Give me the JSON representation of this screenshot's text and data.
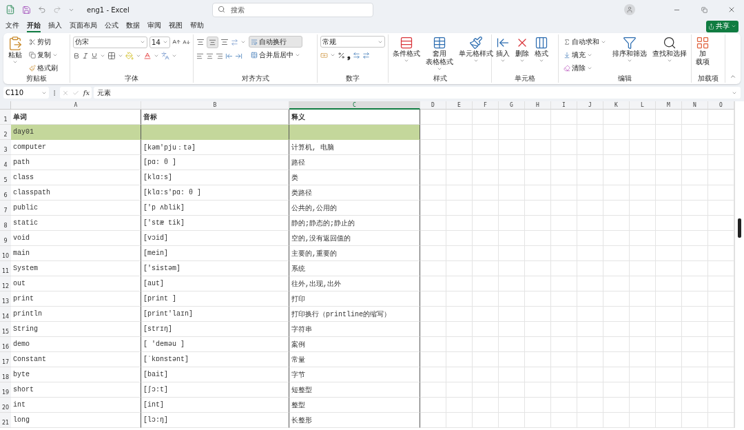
{
  "window": {
    "title": "eng1 - Excel"
  },
  "search": {
    "placeholder": "搜索"
  },
  "menu_tabs": [
    {
      "label": "文件",
      "selected": false
    },
    {
      "label": "开始",
      "selected": true
    },
    {
      "label": "插入",
      "selected": false
    },
    {
      "label": "页面布局",
      "selected": false
    },
    {
      "label": "公式",
      "selected": false
    },
    {
      "label": "数据",
      "selected": false
    },
    {
      "label": "审阅",
      "selected": false
    },
    {
      "label": "视图",
      "selected": false
    },
    {
      "label": "帮助",
      "selected": false
    }
  ],
  "share_button": "共享",
  "ribbon": {
    "clipboard": {
      "label": "剪贴板",
      "paste": "粘贴",
      "cut": "剪切",
      "copy": "复制",
      "format_painter": "格式刷"
    },
    "font": {
      "label": "字体",
      "font_name": "仿宋",
      "font_size": "14"
    },
    "alignment": {
      "label": "对齐方式",
      "middle_align_pressed": true,
      "wrap_text": {
        "label": "自动换行",
        "pressed": true
      },
      "merge": "合并后居中"
    },
    "number": {
      "label": "数字",
      "format": "常规",
      "comma": "❟"
    },
    "styles": {
      "label": "样式",
      "buttons": [
        {
          "kind": "conditional",
          "lines": [
            "条件格式"
          ]
        },
        {
          "kind": "table",
          "lines": [
            "套用",
            "表格格式"
          ]
        },
        {
          "kind": "cellstyle",
          "lines": [
            "单元格样式"
          ]
        }
      ]
    },
    "cells": {
      "label": "单元格",
      "buttons": [
        {
          "kind": "insert",
          "lines": [
            "插入"
          ]
        },
        {
          "kind": "delete",
          "lines": [
            "删除"
          ]
        },
        {
          "kind": "format",
          "lines": [
            "格式"
          ]
        }
      ]
    },
    "editing": {
      "label": "编辑",
      "autosum": "自动求和",
      "fill": "填充",
      "clear": "清除",
      "sort": "排序和筛选",
      "find": "查找和选择"
    },
    "addins": {
      "label": "加载项",
      "lines": [
        "加",
        "载项"
      ]
    }
  },
  "formula_bar": {
    "name_box": "C110",
    "fx": "fx",
    "value": "元素"
  },
  "sheet": {
    "columns": [
      {
        "label": "A",
        "selected": false
      },
      {
        "label": "B",
        "selected": false
      },
      {
        "label": "C",
        "selected": true
      },
      {
        "label": "D",
        "selected": false
      },
      {
        "label": "E",
        "selected": false
      },
      {
        "label": "F",
        "selected": false
      },
      {
        "label": "G",
        "selected": false
      },
      {
        "label": "H",
        "selected": false
      },
      {
        "label": "I",
        "selected": false
      },
      {
        "label": "J",
        "selected": false
      },
      {
        "label": "K",
        "selected": false
      },
      {
        "label": "L",
        "selected": false
      },
      {
        "label": "M",
        "selected": false
      },
      {
        "label": "N",
        "selected": false
      },
      {
        "label": "O",
        "selected": false
      }
    ],
    "rows": [
      {
        "number": "1",
        "kind": "header",
        "cells": [
          "单词",
          "音标",
          "释义"
        ]
      },
      {
        "number": "2",
        "kind": "group",
        "cells": [
          "day01"
        ]
      },
      {
        "number": "3",
        "kind": "word",
        "cells": [
          "computer",
          "[kəm'pju：tə]",
          "计算机, 电脑"
        ]
      },
      {
        "number": "4",
        "kind": "word",
        "cells": [
          "path",
          "[pɑ: θ ]",
          "路径"
        ]
      },
      {
        "number": "5",
        "kind": "word",
        "cells": [
          "class",
          "[klɑ:s]",
          "类"
        ]
      },
      {
        "number": "6",
        "kind": "word",
        "cells": [
          "classpath",
          "[klɑ:s'pɑ: θ  ]",
          "类路径"
        ]
      },
      {
        "number": "7",
        "kind": "word",
        "cells": [
          "public",
          "['p ʌblik]",
          "公共的,公用的"
        ]
      },
      {
        "number": "8",
        "kind": "word",
        "cells": [
          "static",
          "['stæ tik]",
          "静的;静态的;静止的"
        ]
      },
      {
        "number": "9",
        "kind": "word",
        "cells": [
          "void",
          "[vɔid]",
          "空的,没有返回值的"
        ]
      },
      {
        "number": "10",
        "kind": "word",
        "cells": [
          "main",
          "[mein]",
          "主要的,重要的"
        ]
      },
      {
        "number": "11",
        "kind": "word",
        "cells": [
          "System",
          "['sistəm]",
          "系统"
        ]
      },
      {
        "number": "12",
        "kind": "word",
        "cells": [
          "out",
          "[aut]",
          "往外,出现,出外"
        ]
      },
      {
        "number": "13",
        "kind": "word",
        "cells": [
          "print",
          "[print ]",
          "打印"
        ]
      },
      {
        "number": "14",
        "kind": "word",
        "cells": [
          "println",
          "[print'laɪn]",
          "打印换行（printline的缩写）"
        ]
      },
      {
        "number": "15",
        "kind": "word",
        "cells": [
          "String",
          "[strɪŋ]",
          "字符串"
        ]
      },
      {
        "number": "16",
        "kind": "word",
        "cells": [
          "demo",
          "[ 'deməu ]",
          "案例"
        ]
      },
      {
        "number": "17",
        "kind": "word",
        "cells": [
          "Constant",
          "[ˈkɒnstənt]",
          "常量"
        ]
      },
      {
        "number": "18",
        "kind": "word",
        "cells": [
          "byte",
          "[bait]",
          "字节"
        ]
      },
      {
        "number": "19",
        "kind": "word",
        "cells": [
          "short",
          "[ʃɔ:t]",
          "短整型"
        ]
      },
      {
        "number": "20",
        "kind": "word",
        "cells": [
          "int",
          "[int]",
          "整型"
        ]
      },
      {
        "number": "21",
        "kind": "word",
        "cells": [
          "long",
          "[lɔ:ŋ]",
          "长整形"
        ]
      }
    ]
  }
}
